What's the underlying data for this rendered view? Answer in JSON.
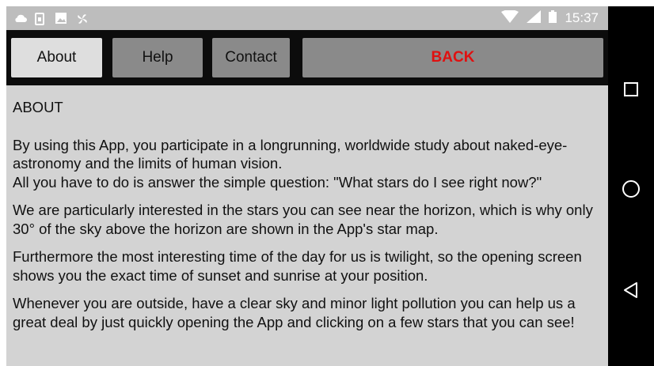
{
  "status_bar": {
    "time": "15:37",
    "icons": [
      "cloud-icon",
      "phone-icon",
      "image-icon",
      "fan-icon",
      "wifi-icon",
      "signal-icon",
      "battery-icon"
    ]
  },
  "toolbar": {
    "about_label": "About",
    "help_label": "Help",
    "contact_label": "Contact",
    "back_label": "BACK",
    "back_color": "#e01010"
  },
  "content": {
    "heading": "ABOUT",
    "paragraphs": [
      "By using this App, you participate in a longrunning, worldwide study about naked-eye-astronomy and the limits of human vision.",
      "All you have to do is answer the simple question: \"What stars do I see right now?\"",
      "We are particularly interested in the stars you can see near the horizon, which is why only 30° of the sky above the horizon are shown in the App's star map.",
      "Furthermore the most interesting time of the day for us is twilight, so the opening screen shows you the exact time of sunset and sunrise at your position.",
      "Whenever you are outside, have a clear sky and minor light pollution you can help us a great deal by just quickly opening the App and clicking on a few stars that you can see!"
    ]
  },
  "nav_bar": {
    "buttons": [
      "recent-apps-icon",
      "home-icon",
      "back-icon"
    ]
  }
}
